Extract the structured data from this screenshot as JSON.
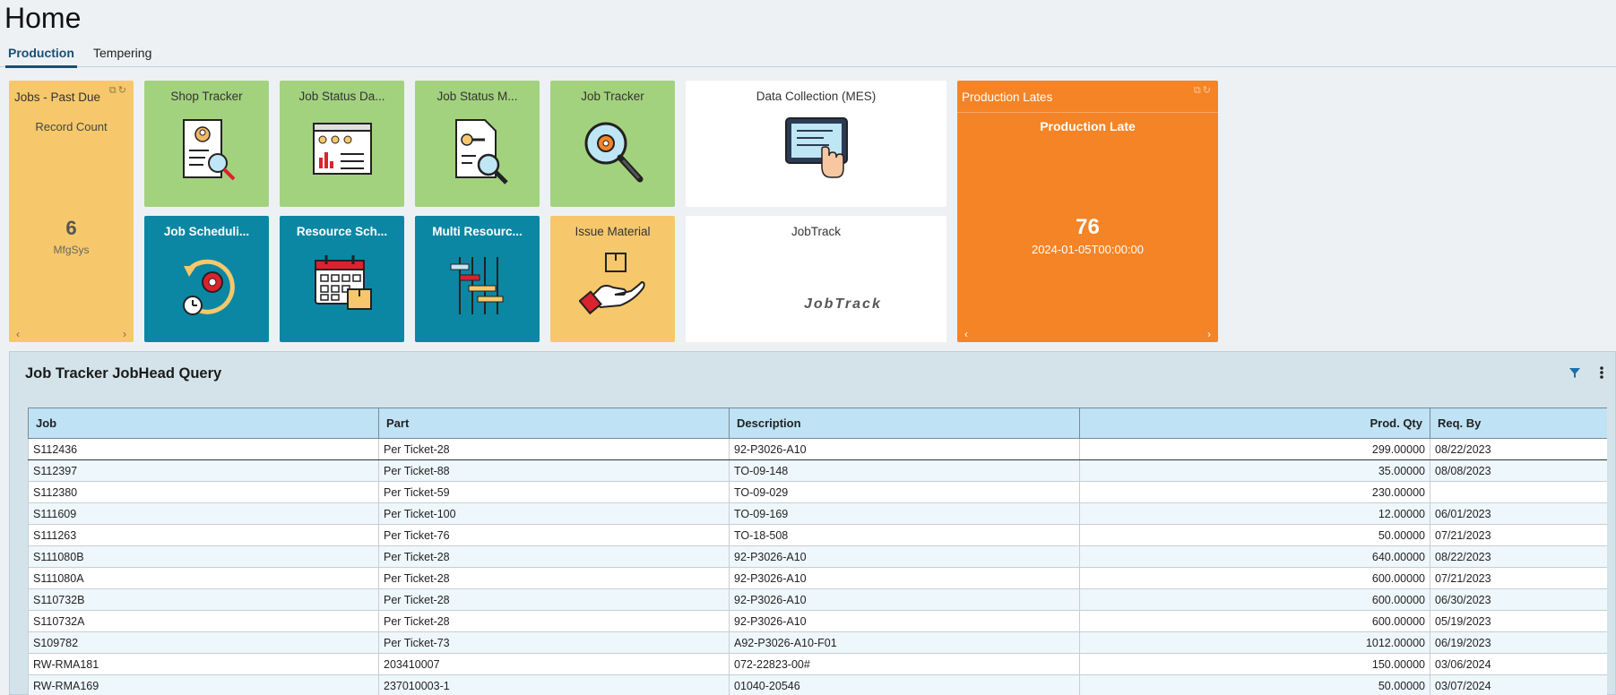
{
  "page": {
    "title": "Home"
  },
  "tabs": [
    {
      "label": "Production",
      "active": true
    },
    {
      "label": "Tempering",
      "active": false
    }
  ],
  "tiles": {
    "past_due": {
      "label": "Jobs - Past Due",
      "subtitle": "Record Count",
      "value": "6",
      "source": "MfgSys"
    },
    "shop_tracker": {
      "label": "Shop Tracker",
      "icon": "document-person-search-icon"
    },
    "job_status_da": {
      "label": "Job Status Da...",
      "icon": "dashboard-window-icon"
    },
    "job_status_m": {
      "label": "Job Status M...",
      "icon": "document-key-search-icon"
    },
    "job_tracker": {
      "label": "Job Tracker",
      "icon": "magnifier-gear-icon"
    },
    "data_collection": {
      "label": "Data Collection (MES)",
      "icon": "tablet-touch-icon"
    },
    "job_scheduling": {
      "label": "Job Scheduli...",
      "icon": "gear-cycle-clock-icon"
    },
    "resource_sch": {
      "label": "Resource Sch...",
      "icon": "calendar-box-icon"
    },
    "multi_resource": {
      "label": "Multi Resourc...",
      "icon": "gantt-bars-icon"
    },
    "issue_material": {
      "label": "Issue Material",
      "icon": "hand-box-icon"
    },
    "jobtrack": {
      "label": "JobTrack",
      "logo": "JobTrack"
    },
    "production_lates": {
      "label": "Production Lates",
      "subtitle": "Production Late",
      "value": "76",
      "date": "2024-01-05T00:00:00"
    }
  },
  "panel": {
    "title": "Job Tracker JobHead Query",
    "columns": [
      "Job",
      "Part",
      "Description",
      "Prod. Qty",
      "Req. By"
    ],
    "rows": [
      [
        "S112436",
        "Per Ticket-28",
        "92-P3026-A10",
        "299.00000",
        "08/22/2023"
      ],
      [
        "S112397",
        "Per Ticket-88",
        "TO-09-148",
        "35.00000",
        "08/08/2023"
      ],
      [
        "S112380",
        "Per Ticket-59",
        "TO-09-029",
        "230.00000",
        ""
      ],
      [
        "S111609",
        "Per Ticket-100",
        "TO-09-169",
        "12.00000",
        "06/01/2023"
      ],
      [
        "S111263",
        "Per Ticket-76",
        "TO-18-508",
        "50.00000",
        "07/21/2023"
      ],
      [
        "S111080B",
        "Per Ticket-28",
        "92-P3026-A10",
        "640.00000",
        "08/22/2023"
      ],
      [
        "S111080A",
        "Per Ticket-28",
        "92-P3026-A10",
        "600.00000",
        "07/21/2023"
      ],
      [
        "S110732B",
        "Per Ticket-28",
        "92-P3026-A10",
        "600.00000",
        "06/30/2023"
      ],
      [
        "S110732A",
        "Per Ticket-28",
        "92-P3026-A10",
        "600.00000",
        "05/19/2023"
      ],
      [
        "S109782",
        "Per Ticket-73",
        "A92-P3026-A10-F01",
        "1012.00000",
        "06/19/2023"
      ],
      [
        "RW-RMA181",
        "203410007",
        "072-22823-00#",
        "150.00000",
        "03/06/2024"
      ],
      [
        "RW-RMA169",
        "237010003-1",
        "01040-20546",
        "50.00000",
        "03/07/2024"
      ]
    ]
  }
}
